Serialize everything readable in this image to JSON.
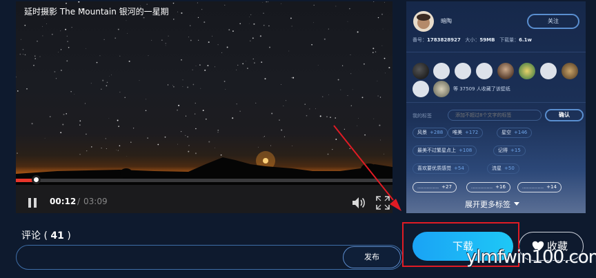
{
  "video": {
    "title": "延时摄影 The Mountain 银河的一星期",
    "time_current": "00:12",
    "time_separator": "/",
    "time_total": "03:09",
    "progress_percent": 6.3
  },
  "comments": {
    "label": "评论",
    "count": "41",
    "publish_label": "发布"
  },
  "panel": {
    "author_name": "暗陶",
    "follow_label": "关注",
    "meta": {
      "id_label": "番号：",
      "id_value": "1783828927",
      "size_label": "大小：",
      "size_value": "59MB",
      "downloads_label": "下载量：",
      "downloads_value": "6.1w"
    },
    "collect_text": "等 37509 人收藏了该壁纸",
    "tag_label": "我的标签",
    "tag_placeholder": "添加不超过8个文字的标签",
    "tag_confirm": "确认",
    "tags": [
      {
        "name": "风景",
        "count": "+288"
      },
      {
        "name": "唯美",
        "count": "+172"
      },
      {
        "name": "星空",
        "count": "+146"
      },
      {
        "name": "最美不过繁星点上",
        "count": "+108"
      },
      {
        "name": "记得",
        "count": "+15"
      },
      {
        "name": "喜欢要优质感觉",
        "count": "+54"
      },
      {
        "name": "流星",
        "count": "+50"
      },
      {
        "name": "..............",
        "count": "+27"
      },
      {
        "name": "..............",
        "count": "+16"
      },
      {
        "name": "..............",
        "count": "+14"
      }
    ],
    "expand_label": "展开更多标签"
  },
  "actions": {
    "download_label": "下载",
    "favorite_label": "收藏"
  },
  "watermark": "ylmfwin100.com",
  "colors": {
    "background": "#0e1a2e",
    "accent_blue": "#1aa3f5",
    "progress_red": "#e8352b",
    "annotation_red": "#e01b24"
  }
}
